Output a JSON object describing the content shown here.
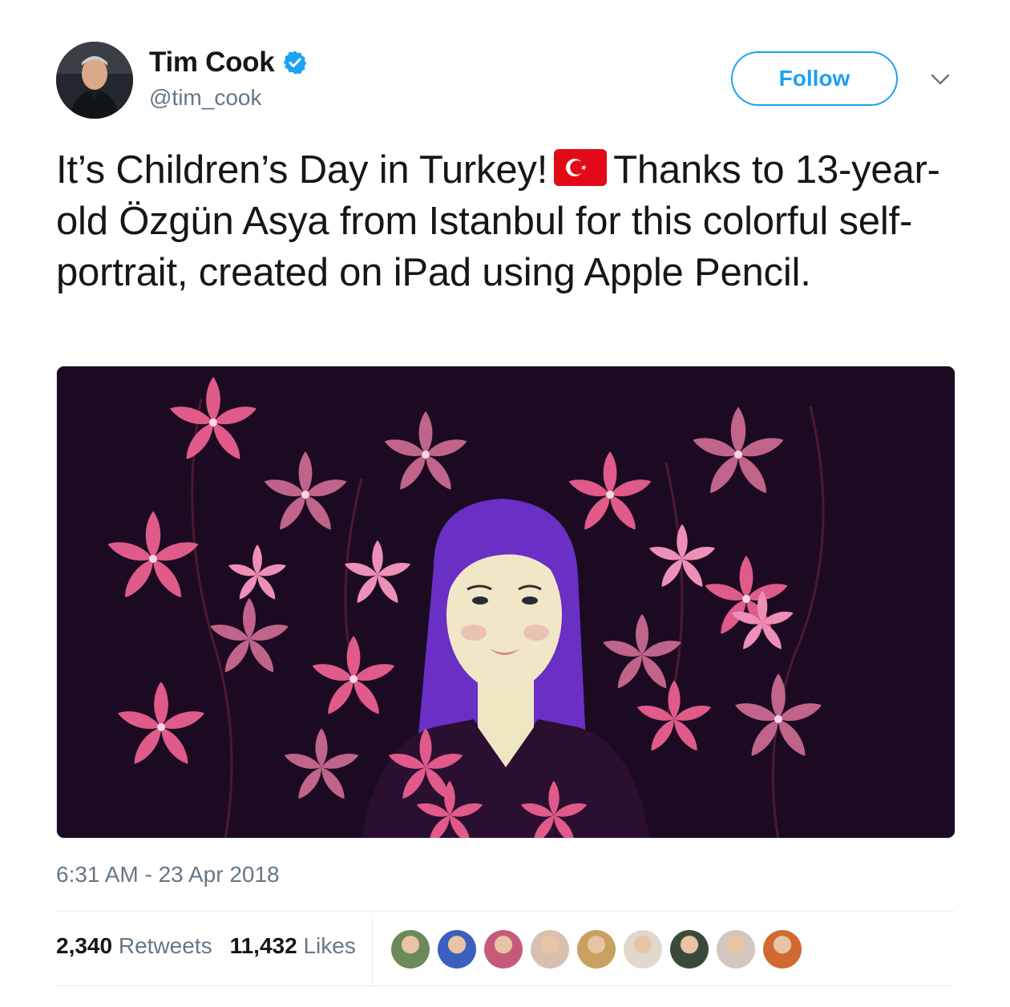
{
  "author": {
    "display_name": "Tim Cook",
    "handle": "@tim_cook",
    "verified": true,
    "avatar_icon": "profile-photo"
  },
  "follow_button": {
    "label": "Follow",
    "color": "#1da1f2"
  },
  "menu_icon": "chevron-down-icon",
  "tweet": {
    "text_part1": "It’s Children’s Day in Turkey!",
    "flag_icon": "turkey-flag-emoji",
    "text_part2": "Thanks to 13-year-old Özgün Asya from Istanbul for this colorful self-portrait, created on iPad using Apple Pencil."
  },
  "media": {
    "icon": "self-portrait-illustration"
  },
  "timestamp": "6:31 AM - 23 Apr 2018",
  "stats": {
    "retweets_count": "2,340",
    "retweets_label": "Retweets",
    "likes_count": "11,432",
    "likes_label": "Likes"
  },
  "liker_avatars": [
    {
      "color": "#6a8a5a"
    },
    {
      "color": "#3a5fbf"
    },
    {
      "color": "#c65a7a"
    },
    {
      "color": "#d8c0b0"
    },
    {
      "color": "#c8a060"
    },
    {
      "color": "#e0d8cc"
    },
    {
      "color": "#3a4a3a"
    },
    {
      "color": "#d0c8c0"
    },
    {
      "color": "#d06a30"
    }
  ]
}
